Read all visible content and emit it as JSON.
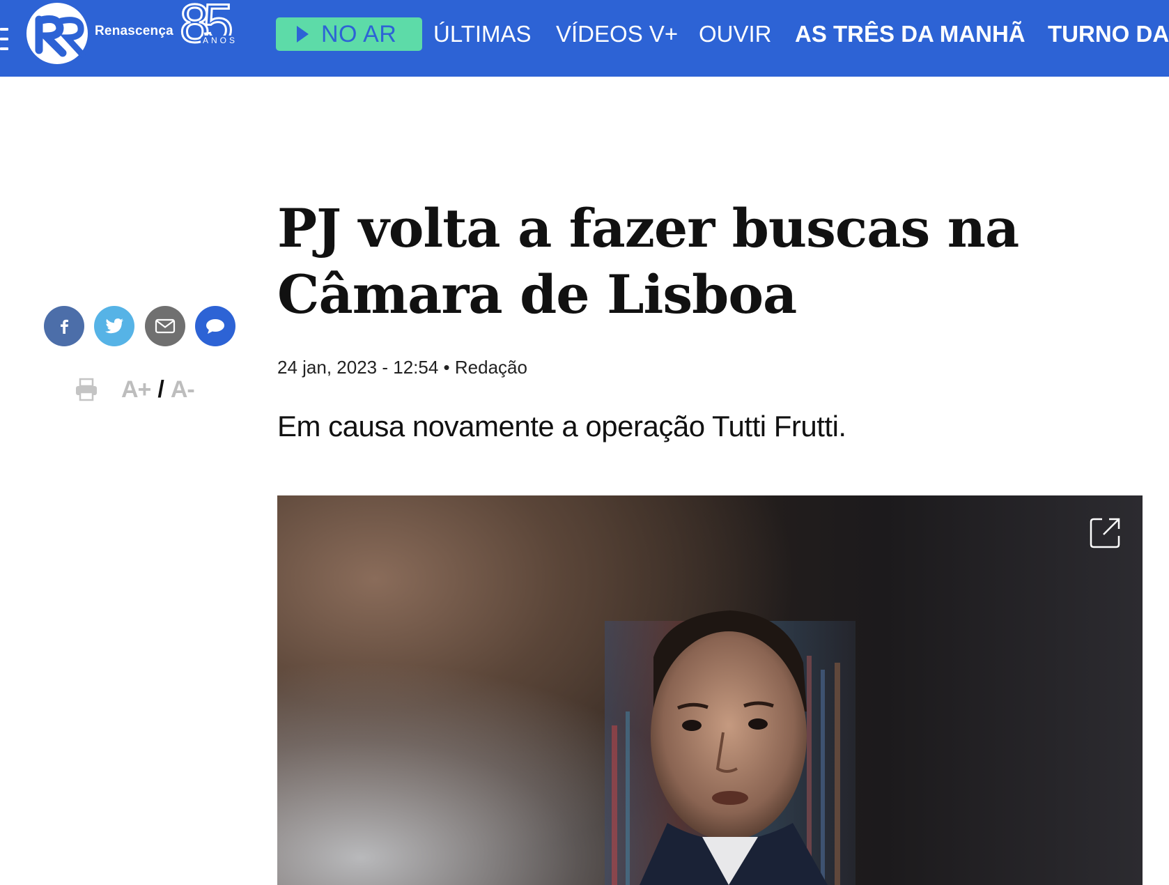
{
  "header": {
    "brand": "Renascença",
    "anniversary_number": "85",
    "anniversary_word": "ANOS",
    "live_button": "NO AR",
    "nav": [
      {
        "label": "ÚLTIMAS"
      },
      {
        "label": "VÍDEOS V+"
      },
      {
        "label": "OUVIR"
      },
      {
        "label": "AS TRÊS DA MANHÃ"
      },
      {
        "label": "TURNO DA"
      }
    ],
    "colors": {
      "bar": "#2d63d5",
      "live": "#5ddba8"
    }
  },
  "sidebar": {
    "share": [
      {
        "icon": "facebook-icon",
        "color": "#4c6ea9"
      },
      {
        "icon": "twitter-icon",
        "color": "#56b3e6"
      },
      {
        "icon": "email-icon",
        "color": "#707070"
      },
      {
        "icon": "comment-icon",
        "color": "#2d63d5"
      }
    ],
    "font_increase": "A+",
    "separator": "/",
    "font_decrease": "A-"
  },
  "article": {
    "title": "PJ volta a fazer buscas na Câmara de Lisboa",
    "date": "24 jan, 2023 - 12:54",
    "separator": "•",
    "author": "Redação",
    "lead": "Em causa novamente a operação Tutti Frutti."
  }
}
